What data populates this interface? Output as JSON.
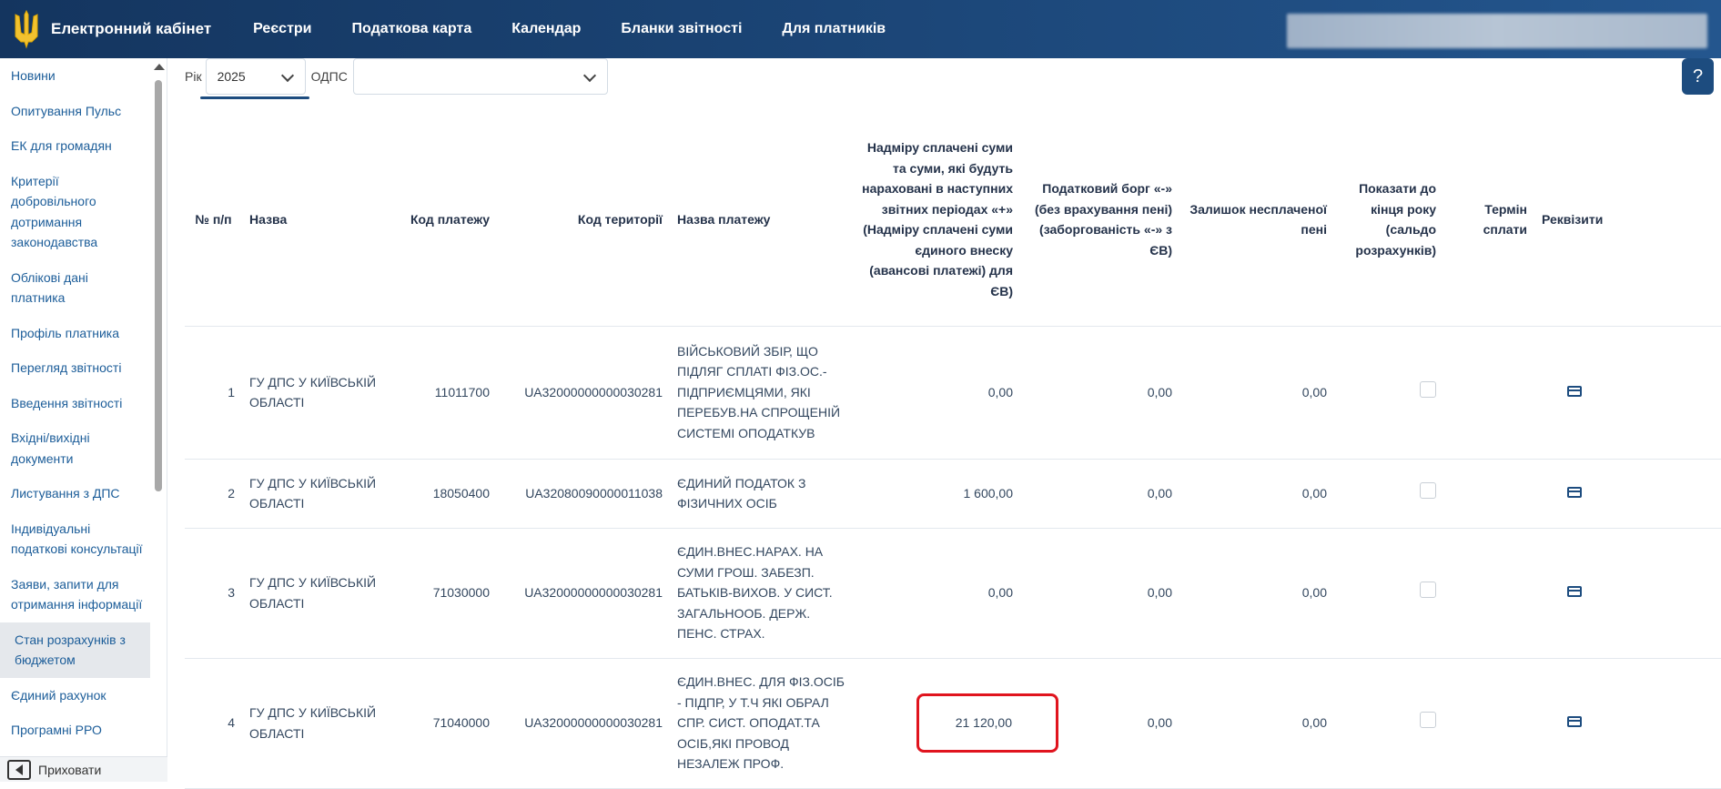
{
  "header": {
    "brand": "Електронний кабінет",
    "nav": [
      "Реєстри",
      "Податкова карта",
      "Календар",
      "Бланки звітності",
      "Для платників"
    ]
  },
  "sidebar": {
    "items": [
      "Новини",
      "Опитування Пульс",
      "ЕК для громадян",
      "Критерії добровільного дотримання законодавства",
      "Облікові дані платника",
      "Профіль платника",
      "Перегляд звітності",
      "Введення звітності",
      "Вхідні/вихідні документи",
      "Листування з ДПС",
      "Індивідуальні податкові консультації",
      "Заяви, запити для отримання інформації",
      "Стан розрахунків з бюджетом",
      "Єдиний рахунок",
      "Програмні РРО"
    ],
    "active_item": "Стан розрахунків з бюджетом",
    "hide_label": "Приховати"
  },
  "filters": {
    "year_label": "Рік",
    "year_value": "2025",
    "odps_label": "ОДПС",
    "odps_value": ""
  },
  "help_label": "?",
  "table": {
    "headers": {
      "num": "№ п/п",
      "name": "Назва",
      "payment_code": "Код платежу",
      "territory_code": "Код території",
      "payment_name": "Назва платежу",
      "overpaid": "Надміру сплачені суми та суми, які будуть нараховані в наступних звітних періодах «+» (Надміру сплачені суми єдиного внеску (авансові платежі) для ЄВ)",
      "tax_debt": "Податковий борг «-» (без врахування пені) (заборгованість «-» з ЄВ)",
      "penalty": "Залишок несплаченої пені",
      "show_end_year": "Показати до кінця року (сальдо розрахунків)",
      "due_date": "Термін сплати",
      "requisites": "Реквізити"
    },
    "rows": [
      {
        "num": "1",
        "name": "ГУ ДПС У КИЇВСЬКІЙ ОБЛАСТІ",
        "payment_code": "11011700",
        "territory_code": "UA32000000000030281",
        "payment_name": "ВІЙСЬКОВИЙ ЗБІР, ЩО ПІДЛЯГ СПЛАТІ ФІЗ.ОС.-ПІДПРИЄМЦЯМИ, ЯКІ ПЕРЕБУВ.НА СПРОЩЕНІЙ СИСТЕМІ ОПОДАТКУВ",
        "overpaid": "0,00",
        "tax_debt": "0,00",
        "penalty": "0,00",
        "due_date": ""
      },
      {
        "num": "2",
        "name": "ГУ ДПС У КИЇВСЬКІЙ ОБЛАСТІ",
        "payment_code": "18050400",
        "territory_code": "UA32080090000011038",
        "payment_name": "ЄДИНИЙ ПОДАТОК З ФІЗИЧНИХ ОСІБ",
        "overpaid": "1 600,00",
        "tax_debt": "0,00",
        "penalty": "0,00",
        "due_date": ""
      },
      {
        "num": "3",
        "name": "ГУ ДПС У КИЇВСЬКІЙ ОБЛАСТІ",
        "payment_code": "71030000",
        "territory_code": "UA32000000000030281",
        "payment_name": "ЄДИН.ВНЕС.НАРАХ. НА СУМИ ГРОШ. ЗАБЕЗП. БАТЬКІВ-ВИХОВ. У СИСТ. ЗАГАЛЬНООБ. ДЕРЖ. ПЕНС. СТРАХ.",
        "overpaid": "0,00",
        "tax_debt": "0,00",
        "penalty": "0,00",
        "due_date": ""
      },
      {
        "num": "4",
        "name": "ГУ ДПС У КИЇВСЬКІЙ ОБЛАСТІ",
        "payment_code": "71040000",
        "territory_code": "UA32000000000030281",
        "payment_name": "ЄДИН.ВНЕС. ДЛЯ ФІЗ.ОСІБ - ПІДПР, У Т.Ч ЯКІ ОБРАЛ СПР. СИСТ. ОПОДАТ.ТА ОСІБ,ЯКІ ПРОВОД НЕЗАЛЕЖ ПРОФ.",
        "overpaid": "21 120,00",
        "tax_debt": "0,00",
        "penalty": "0,00",
        "due_date": ""
      }
    ]
  },
  "colors": {
    "header_bg": "#1c4779",
    "link": "#1c5d99",
    "highlight": "#e0141e"
  },
  "icons": {
    "logo": "trident-icon",
    "requisites": "credit-card-icon",
    "help": "question-icon",
    "hide": "collapse-left-icon"
  }
}
